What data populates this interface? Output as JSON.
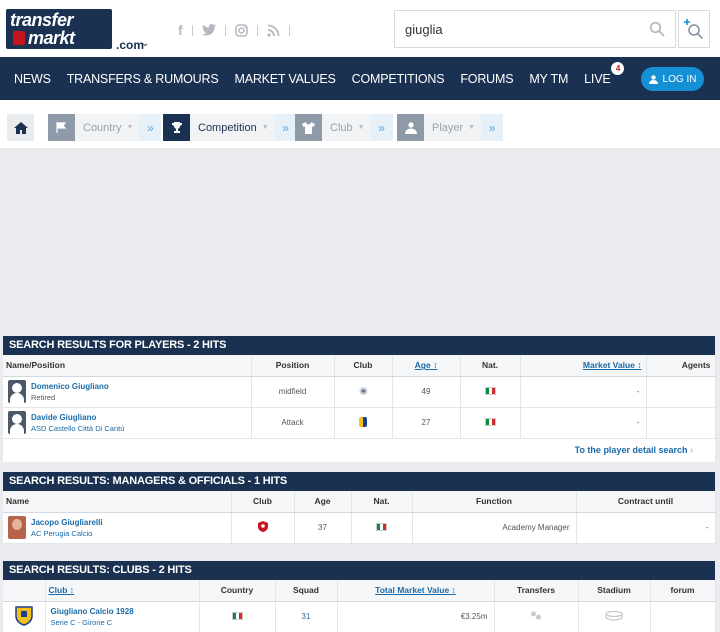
{
  "header": {
    "logo_line1": "transfer",
    "logo_line2": "markt",
    "domain": ".com",
    "search_value": "giuglia",
    "login_label": "LOG IN"
  },
  "nav": {
    "items": [
      "NEWS",
      "TRANSFERS & RUMOURS",
      "MARKET VALUES",
      "COMPETITIONS",
      "FORUMS",
      "MY TM",
      "LIVE"
    ],
    "live_badge": "4"
  },
  "selector": {
    "country": "Country",
    "competition": "Competition",
    "club": "Club",
    "player": "Player"
  },
  "players": {
    "title": "SEARCH RESULTS FOR PLAYERS - 2 HITS",
    "columns": [
      "Name/Position",
      "Position",
      "Club",
      "Age",
      "Nat.",
      "Market Value",
      "Agents"
    ],
    "rows": [
      {
        "name": "Domenico Giugliano",
        "sub": "Retired",
        "position": "midfield",
        "age": "49",
        "value": "-"
      },
      {
        "name": "Davide Giugliano",
        "sub": "ASD Castello Città Di Cantù",
        "position": "Attack",
        "age": "27",
        "value": "-"
      }
    ],
    "footer_link": "To the player detail search"
  },
  "managers": {
    "title": "SEARCH RESULTS: MANAGERS & OFFICIALS - 1 HITS",
    "columns": [
      "Name",
      "Club",
      "Age",
      "Nat.",
      "Function",
      "Contract until"
    ],
    "rows": [
      {
        "name": "Jacopo Giugliarelli",
        "sub": "AC Perugia Calcio",
        "age": "37",
        "function": "Academy Manager",
        "contract": "-"
      }
    ]
  },
  "clubs": {
    "title": "SEARCH RESULTS: CLUBS - 2 HITS",
    "columns": [
      "Club",
      "Country",
      "Squad",
      "Total Market Value",
      "Transfers",
      "Stadium",
      "forum"
    ],
    "rows": [
      {
        "name": "Giugliano Calcio 1928",
        "sub": "Serie C - Girone C",
        "squad": "31",
        "value": "€3.25m"
      }
    ]
  },
  "colors": {
    "navy": "#1a3151",
    "link": "#1a6ba8",
    "login": "#1590d4"
  }
}
